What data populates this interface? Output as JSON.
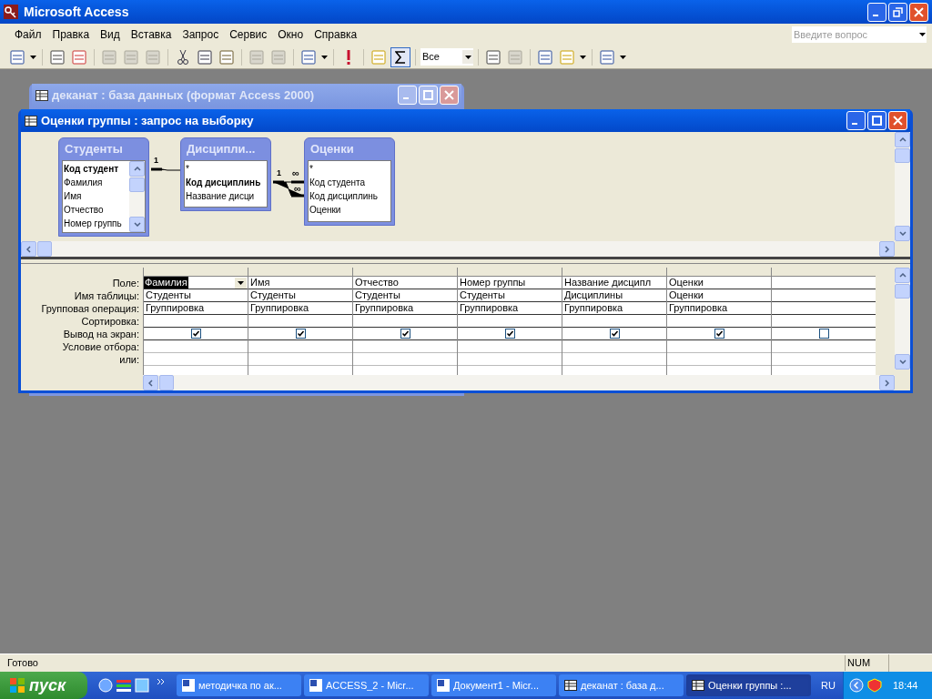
{
  "app": {
    "title": "Microsoft Access"
  },
  "menu": [
    {
      "label": "Файл"
    },
    {
      "label": "Правка"
    },
    {
      "label": "Вид"
    },
    {
      "label": "Вставка"
    },
    {
      "label": "Запрос"
    },
    {
      "label": "Сервис"
    },
    {
      "label": "Окно"
    },
    {
      "label": "Справка"
    }
  ],
  "help_box": {
    "placeholder": "Введите вопрос"
  },
  "toolbar": {
    "top_values": "Все",
    "totals_on": true
  },
  "db_window": {
    "title": "деканат : база данных (формат Access 2000)"
  },
  "query_window": {
    "title": "Оценки группы : запрос на выборку"
  },
  "tables": [
    {
      "title": "Студенты",
      "scroll": true,
      "fields": [
        {
          "name": "Код студент",
          "bold": true
        },
        {
          "name": "Фамилия",
          "bold": false
        },
        {
          "name": "Имя",
          "bold": false
        },
        {
          "name": "Отчество",
          "bold": false
        },
        {
          "name": "Номер группь",
          "bold": false
        }
      ]
    },
    {
      "title": "Дисципли...",
      "scroll": false,
      "fields": [
        {
          "name": "*",
          "bold": false
        },
        {
          "name": "Код дисциплинь",
          "bold": true
        },
        {
          "name": "Название дисци",
          "bold": false
        }
      ]
    },
    {
      "title": "Оценки",
      "scroll": false,
      "fields": [
        {
          "name": "*",
          "bold": false
        },
        {
          "name": "Код студента",
          "bold": false
        },
        {
          "name": "Код дисциплинь",
          "bold": false
        },
        {
          "name": "Оценки",
          "bold": false
        }
      ]
    }
  ],
  "joins": [
    {
      "one": "1"
    },
    {
      "one": "1",
      "many": "∞"
    },
    {
      "many": "∞"
    }
  ],
  "grid": {
    "row_labels": [
      "Поле:",
      "Имя таблицы:",
      "Групповая операция:",
      "Сортировка:",
      "Вывод на экран:",
      "Условие отбора:",
      "или:"
    ],
    "columns": [
      {
        "field": "Фамилия",
        "table": "Студенты",
        "total": "Группировка",
        "show": true,
        "selected": true
      },
      {
        "field": "Имя",
        "table": "Студенты",
        "total": "Группировка",
        "show": true,
        "selected": false
      },
      {
        "field": "Отчество",
        "table": "Студенты",
        "total": "Группировка",
        "show": true,
        "selected": false
      },
      {
        "field": "Номер группы",
        "table": "Студенты",
        "total": "Группировка",
        "show": true,
        "selected": false
      },
      {
        "field": "Название дисципл",
        "table": "Дисциплины",
        "total": "Группировка",
        "show": true,
        "selected": false
      },
      {
        "field": "Оценки",
        "table": "Оценки",
        "total": "Группировка",
        "show": true,
        "selected": false
      },
      {
        "show": false,
        "selected": false
      }
    ]
  },
  "status_bar": {
    "text": "Готово",
    "indicator": "NUM"
  },
  "taskbar": {
    "start": "пуск",
    "tasks": [
      {
        "label": "методичка по ак...",
        "kind": "word",
        "selected": false
      },
      {
        "label": "ACCESS_2 - Micr...",
        "kind": "word",
        "selected": false
      },
      {
        "label": "Документ1 - Micr...",
        "kind": "word",
        "selected": false
      },
      {
        "label": "деканат : база д...",
        "kind": "access",
        "selected": false
      },
      {
        "label": "Оценки группы :...",
        "kind": "access",
        "selected": true
      }
    ],
    "language": "RU",
    "time": "18:44"
  }
}
